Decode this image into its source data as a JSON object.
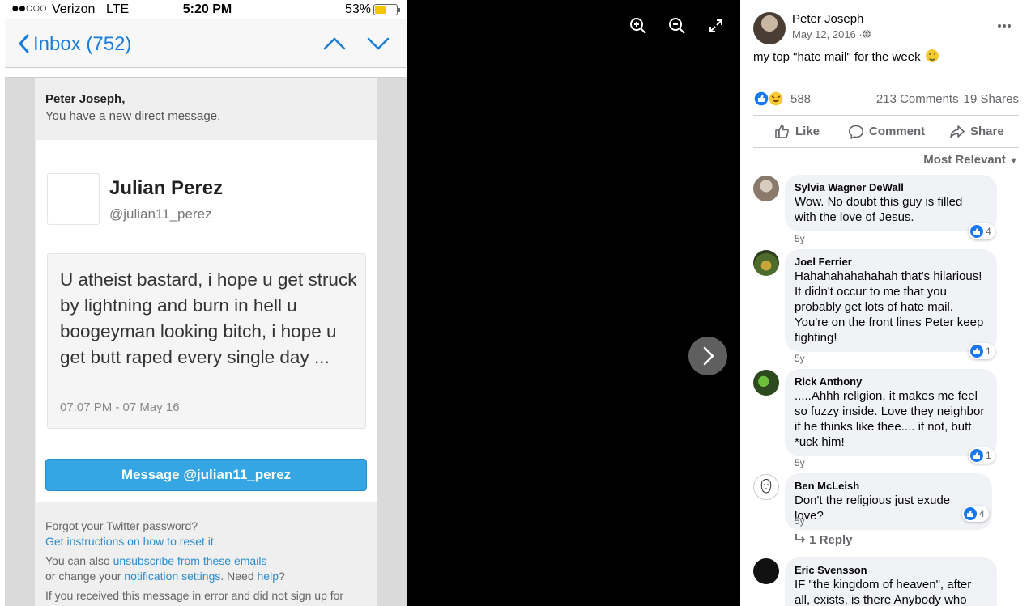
{
  "status_bar": {
    "signal": "●●○○○",
    "carrier": "Verizon",
    "network": "LTE",
    "time": "5:20 PM",
    "battery_pct": "53%",
    "battery_level": 0.53
  },
  "mail_nav": {
    "back_label": "Inbox (752)"
  },
  "email": {
    "greeting": "Peter Joseph,",
    "notice": "You have a new direct message.",
    "sender_name": "Julian Perez",
    "sender_handle": "@julian11_perez",
    "message": "U atheist bastard, i hope u get struck by lightning and burn in hell u boogeyman looking bitch, i hope u get butt raped every single day ...",
    "timestamp": "07:07 PM - 07 May 16",
    "message_button": "Message @julian11_perez",
    "footer": {
      "forgot": "Forgot your Twitter password?",
      "instructions_link": "Get instructions on how to reset it.",
      "also_prefix": "You can also ",
      "unsubscribe_link": "unsubscribe from these emails",
      "or_change": "or change your ",
      "notification_link": "notification settings",
      "need": ". Need ",
      "help_link": "help",
      "qmark": "?",
      "error_line": "If you received this message in error and did not sign up for"
    }
  },
  "post": {
    "author": "Peter Joseph",
    "date": "May 12, 2016 ·",
    "caption": "my top \"hate mail\" for the week",
    "reactions_count": "588",
    "comments": "213 Comments",
    "shares": "19 Shares",
    "actions": {
      "like": "Like",
      "comment": "Comment",
      "share": "Share"
    },
    "sort_label": "Most Relevant"
  },
  "comments": [
    {
      "name": "Sylvia Wagner DeWall",
      "text": "Wow. No doubt this guy is filled with the love of Jesus.",
      "likes": "4",
      "time": "5y"
    },
    {
      "name": "Joel Ferrier",
      "text": "Hahahahahahahah that's hilarious! It didn't occur to me that you probably get lots of hate mail. You're on the front lines Peter keep fighting!",
      "likes": "1",
      "time": "5y"
    },
    {
      "name": "Rick Anthony",
      "text": ".....Ahhh religion, it makes me feel so fuzzy inside. Love they neighbor if he thinks like thee.... if not, butt *uck him!",
      "likes": "1",
      "time": "5y"
    },
    {
      "name": "Ben McLeish",
      "text": "Don't the religious just exude love?",
      "likes": "4",
      "time": "5y",
      "replies": "1 Reply"
    },
    {
      "name": "Eric Svensson",
      "text": "IF \"the kingdom of heaven\", after all, exists, is there Anybody who"
    }
  ],
  "colors": {
    "ios_blue": "#1a7ddb",
    "twitter_button": "#35a5e4",
    "fb_blue": "#1877f2",
    "fb_gray": "#65676b"
  }
}
